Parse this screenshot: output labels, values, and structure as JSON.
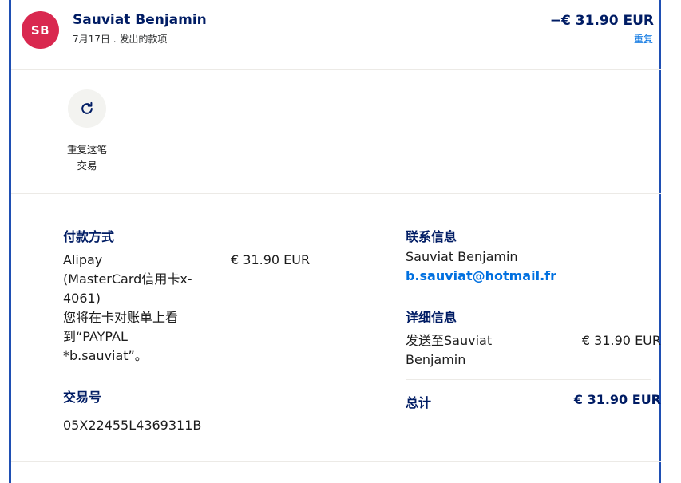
{
  "header": {
    "avatar_initials": "SB",
    "name": "Sauviat Benjamin",
    "subtitle": "7月17日 . 发出的款项",
    "amount": "−€ 31.90 EUR",
    "repeat_link": "重复"
  },
  "action": {
    "icon": "refresh-icon",
    "label_line1": "重复这笔",
    "label_line2": "交易"
  },
  "payment": {
    "heading": "付款方式",
    "method_lines": [
      "Alipay",
      "(MasterCard信用卡x-",
      "4061)",
      "您将在卡对账单上看",
      "到“PAYPAL",
      "*b.sauviat”。"
    ],
    "amount": "€ 31.90 EUR"
  },
  "transaction": {
    "heading": "交易号",
    "id": "05X22455L4369311B"
  },
  "contact": {
    "heading": "联系信息",
    "name": "Sauviat Benjamin",
    "email": "b.sauviat@hotmail.fr"
  },
  "info": {
    "heading": "详细信息",
    "sent_line1": "发送至Sauviat",
    "sent_line2": "Benjamin",
    "sent_amount": "€ 31.90 EUR",
    "total_label": "总计",
    "total_amount": "€ 31.90 EUR"
  },
  "colors": {
    "navy": "#001c64",
    "link": "#0070e0",
    "avatar": "#d9284f",
    "frame": "#1f4fb3"
  }
}
